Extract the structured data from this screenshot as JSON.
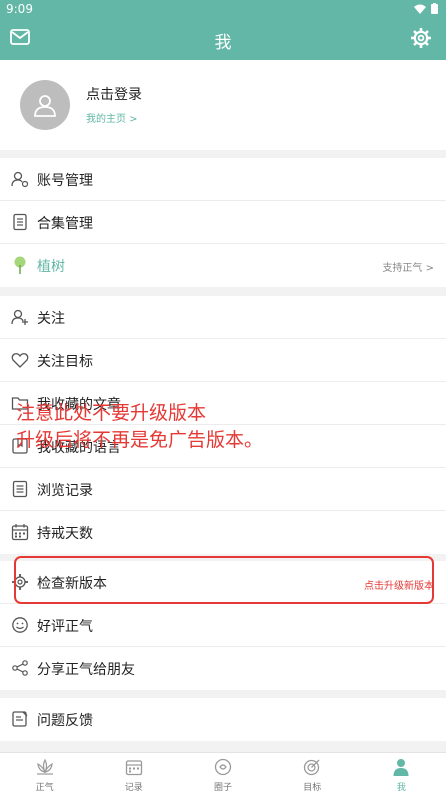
{
  "status_bar": {
    "time": "9:09"
  },
  "header": {
    "title": "我"
  },
  "profile": {
    "login": "点击登录",
    "homepage": "我的主页 >"
  },
  "group1": [
    {
      "label": "账号管理",
      "icon": "user-gear-icon"
    },
    {
      "label": "合集管理",
      "icon": "document-icon"
    },
    {
      "label": "植树",
      "icon": "tree-icon",
      "right": "支持正气 >"
    }
  ],
  "group2": [
    {
      "label": "关注",
      "icon": "user-plus-icon"
    },
    {
      "label": "关注目标",
      "icon": "heart-icon"
    },
    {
      "label": "我收藏的文章",
      "icon": "folder-icon"
    },
    {
      "label": "我收藏的语言",
      "icon": "bookmark-icon"
    },
    {
      "label": "浏览记录",
      "icon": "list-icon"
    },
    {
      "label": "持戒天数",
      "icon": "calendar-icon"
    }
  ],
  "group3": [
    {
      "label": "检查新版本",
      "icon": "gear-icon",
      "right": "点击升级新版本"
    },
    {
      "label": "好评正气",
      "icon": "smile-icon"
    },
    {
      "label": "分享正气给朋友",
      "icon": "share-icon"
    }
  ],
  "group4": [
    {
      "label": "问题反馈",
      "icon": "edit-icon"
    }
  ],
  "overlay": {
    "line1": "注意此处不要升级版本",
    "line2": "升级后将不再是免广告版本。"
  },
  "bottom_nav": [
    {
      "label": "正气",
      "icon": "lotus-icon"
    },
    {
      "label": "记录",
      "icon": "calendar-icon"
    },
    {
      "label": "圈子",
      "icon": "circle-icon"
    },
    {
      "label": "目标",
      "icon": "target-icon"
    },
    {
      "label": "我",
      "icon": "person-icon",
      "active": true
    }
  ],
  "colors": {
    "accent": "#62b7a6",
    "warning": "#e53935"
  }
}
